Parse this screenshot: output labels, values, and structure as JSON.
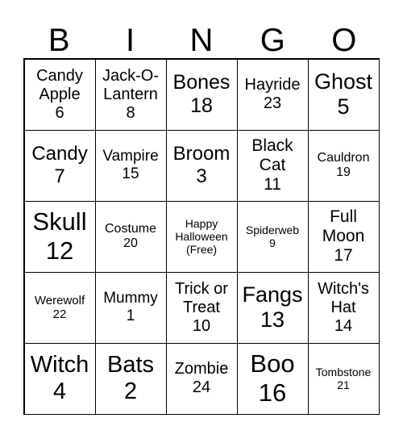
{
  "header": [
    "B",
    "I",
    "N",
    "G",
    "O"
  ],
  "cells": [
    {
      "label": "Candy Apple",
      "number": "6"
    },
    {
      "label": "Jack-O-Lantern",
      "number": "8"
    },
    {
      "label": "Bones",
      "number": "18"
    },
    {
      "label": "Hayride",
      "number": "23"
    },
    {
      "label": "Ghost",
      "number": "5"
    },
    {
      "label": "Candy",
      "number": "7"
    },
    {
      "label": "Vampire",
      "number": "15"
    },
    {
      "label": "Broom",
      "number": "3"
    },
    {
      "label": "Black Cat",
      "number": "11"
    },
    {
      "label": "Cauldron",
      "number": "19"
    },
    {
      "label": "Skull",
      "number": "12"
    },
    {
      "label": "Costume",
      "number": "20"
    },
    {
      "label": "Happy Halloween",
      "number": "(Free)"
    },
    {
      "label": "Spiderweb",
      "number": "9"
    },
    {
      "label": "Full Moon",
      "number": "17"
    },
    {
      "label": "Werewolf",
      "number": "22"
    },
    {
      "label": "Mummy",
      "number": "1"
    },
    {
      "label": "Trick or Treat",
      "number": "10"
    },
    {
      "label": "Fangs",
      "number": "13"
    },
    {
      "label": "Witch's Hat",
      "number": "14"
    },
    {
      "label": "Witch",
      "number": "4"
    },
    {
      "label": "Bats",
      "number": "2"
    },
    {
      "label": "Zombie",
      "number": "24"
    },
    {
      "label": "Boo",
      "number": "16"
    },
    {
      "label": "Tombstone",
      "number": "21"
    }
  ]
}
